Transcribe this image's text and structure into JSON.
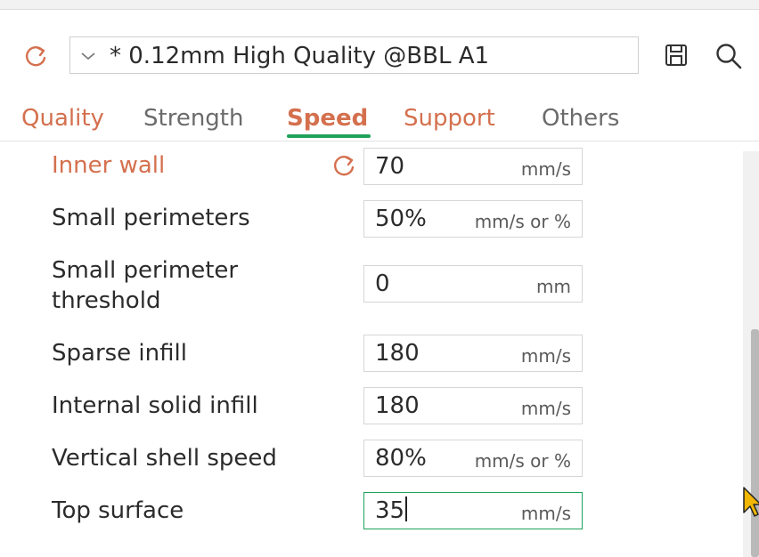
{
  "preset": {
    "value": "* 0.12mm High Quality @BBL A1"
  },
  "icons": {
    "reset": "reset-arrow-icon",
    "dropdown": "chevron-down-icon",
    "save": "save-icon",
    "search": "search-icon"
  },
  "tabs": [
    {
      "label": "Quality",
      "modified": true
    },
    {
      "label": "Strength",
      "modified": false
    },
    {
      "label": "Speed",
      "active": true
    },
    {
      "label": "Support",
      "modified": true
    },
    {
      "label": "Others",
      "modified": false
    }
  ],
  "settings": [
    {
      "label": "Inner wall",
      "value": "70",
      "unit": "mm/s",
      "modified": true
    },
    {
      "label": "Small perimeters",
      "value": "50%",
      "unit": "mm/s or %"
    },
    {
      "label_line1": "Small perimeter",
      "label_line2": "threshold",
      "value": "0",
      "unit": "mm"
    },
    {
      "label": "Sparse infill",
      "value": "180",
      "unit": "mm/s"
    },
    {
      "label": "Internal solid infill",
      "value": "180",
      "unit": "mm/s"
    },
    {
      "label": "Vertical shell speed",
      "value": "80%",
      "unit": "mm/s or %"
    },
    {
      "label": "Top surface",
      "value": "35",
      "unit": "mm/s",
      "focused": true
    }
  ],
  "colors": {
    "accent_green": "#1fa25a",
    "modified_orange": "#d4704e",
    "text": "#2b2b2b"
  }
}
